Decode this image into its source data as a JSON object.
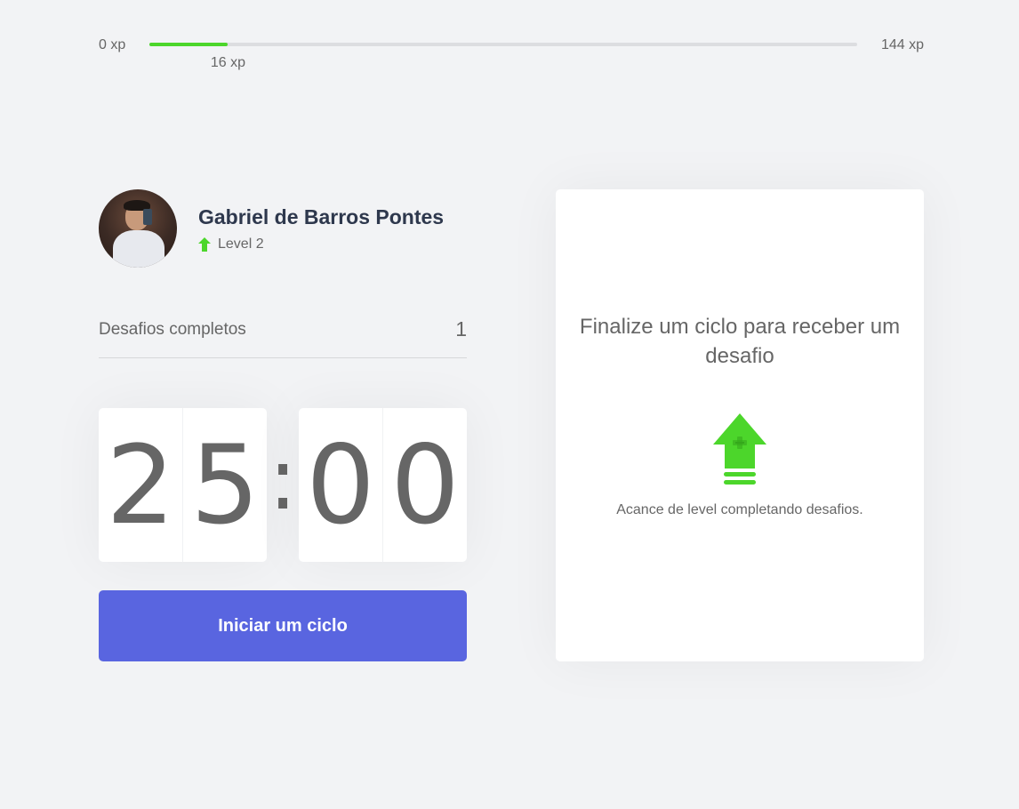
{
  "xp": {
    "min_label": "0 xp",
    "max_label": "144 xp",
    "current_label": "16 xp",
    "current": 16,
    "max": 144
  },
  "profile": {
    "name": "Gabriel de Barros Pontes",
    "level_label": "Level 2"
  },
  "completed": {
    "label": "Desafios completos",
    "value": "1"
  },
  "countdown": {
    "minute_left": "2",
    "minute_right": "5",
    "separator": ":",
    "second_left": "0",
    "second_right": "0"
  },
  "start_button": {
    "label": "Iniciar um ciclo"
  },
  "challenge": {
    "title": "Finalize um ciclo para receber um desafio",
    "description": "Acance de level completando desafios."
  },
  "colors": {
    "accent_green": "#4cd62b",
    "button_blue": "#5965e0",
    "background": "#f2f3f5",
    "title_dark": "#2e384d",
    "text": "#666666"
  },
  "icons": {
    "level": "level-up-arrow-icon",
    "challenge": "level-up-arrow-icon"
  }
}
